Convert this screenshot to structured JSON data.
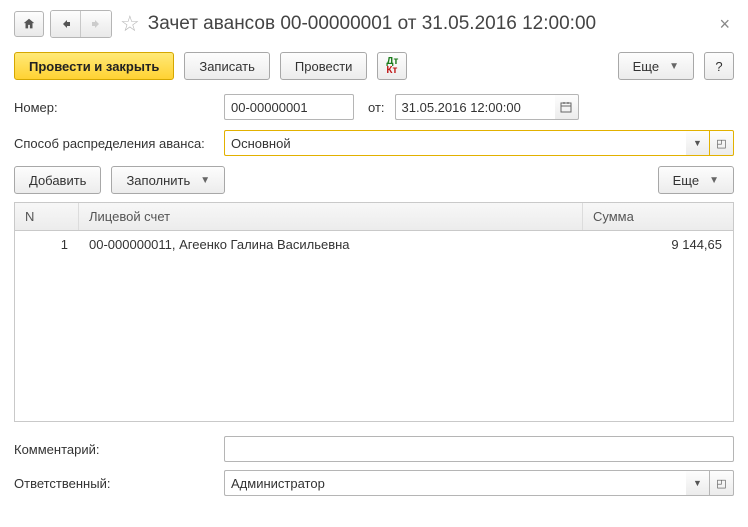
{
  "titlebar": {
    "title": "Зачет авансов 00-00000001 от 31.05.2016 12:00:00"
  },
  "toolbar": {
    "post_and_close": "Провести и закрыть",
    "write": "Записать",
    "post": "Провести",
    "more": "Еще",
    "help": "?"
  },
  "form": {
    "number_label": "Номер:",
    "number_value": "00-00000001",
    "from_label": "от:",
    "date_value": "31.05.2016 12:00:00",
    "method_label": "Способ распределения аванса:",
    "method_value": "Основной"
  },
  "subtoolbar": {
    "add": "Добавить",
    "fill": "Заполнить",
    "more": "Еще"
  },
  "table": {
    "columns": {
      "n": "N",
      "account": "Лицевой счет",
      "sum": "Сумма"
    },
    "rows": [
      {
        "n": "1",
        "account": "00-000000011, Агеенко Галина Васильевна",
        "sum": "9 144,65"
      }
    ]
  },
  "bottom": {
    "comment_label": "Комментарий:",
    "comment_value": "",
    "responsible_label": "Ответственный:",
    "responsible_value": "Администратор"
  }
}
